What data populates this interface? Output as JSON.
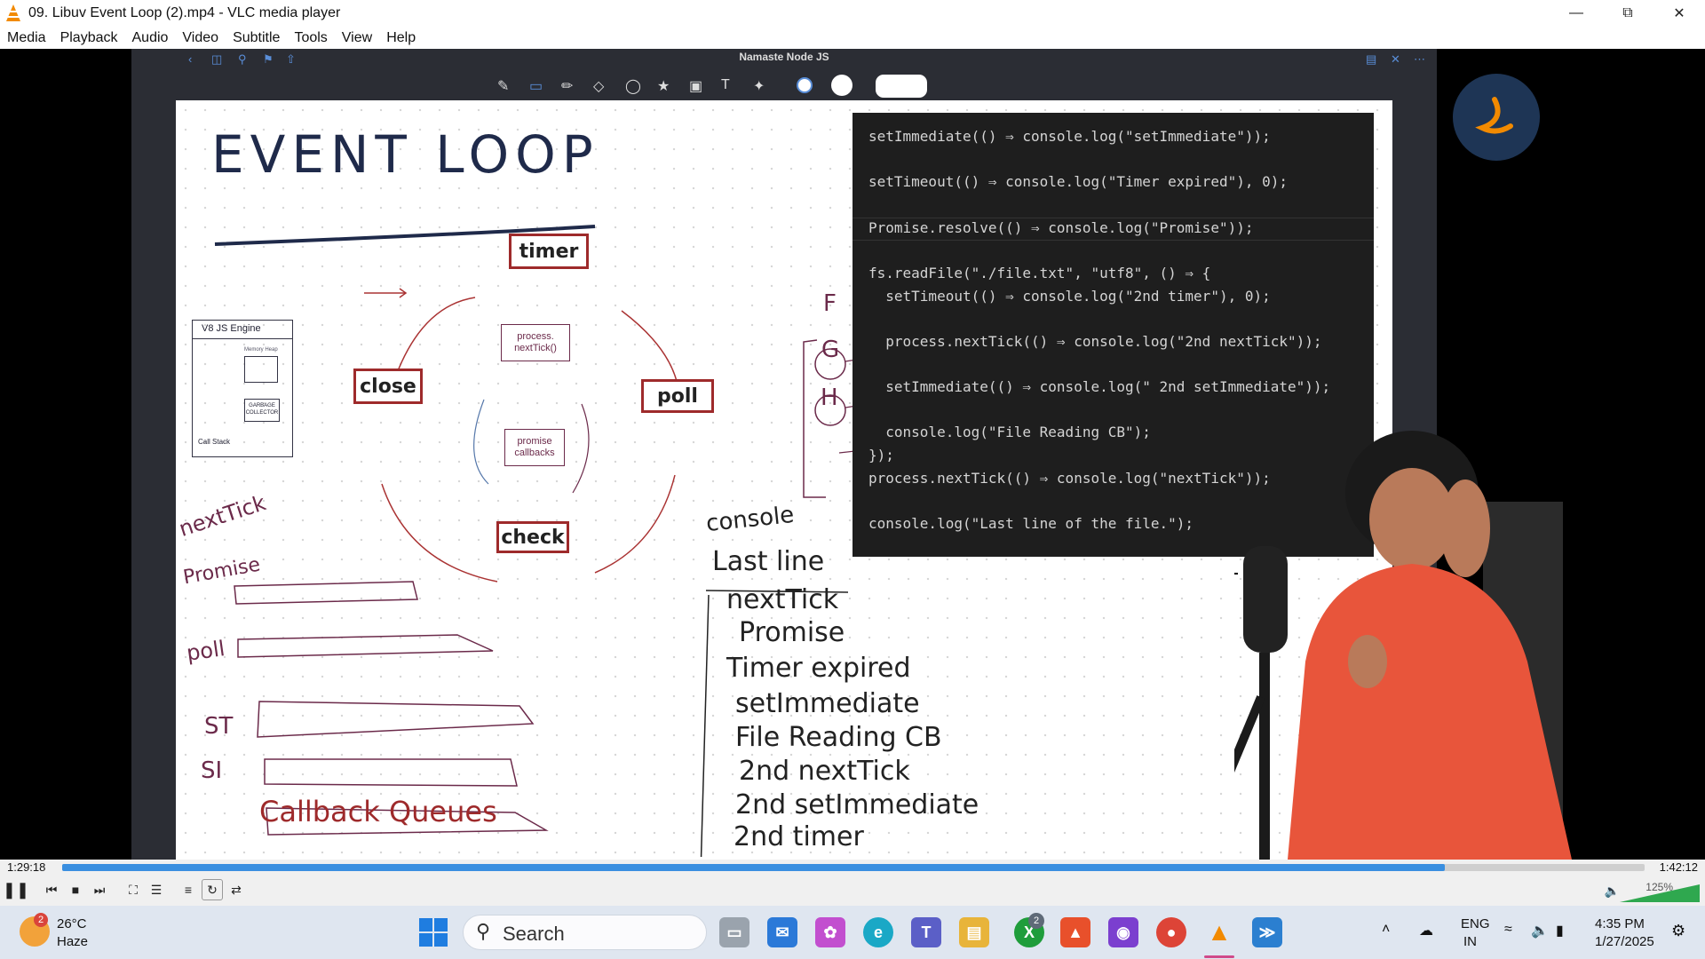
{
  "window": {
    "title": "09. Libuv  Event Loop (2).mp4 - VLC media player",
    "controls": [
      "minimize",
      "maximize",
      "close"
    ]
  },
  "menu": [
    "Media",
    "Playback",
    "Audio",
    "Video",
    "Subtitle",
    "Tools",
    "View",
    "Help"
  ],
  "video": {
    "notebook_title": "Namaste Node JS",
    "whiteboard": {
      "title": "EVENT LOOP",
      "phases": [
        "timer",
        "poll",
        "check",
        "close"
      ],
      "inner_boxes": [
        "process. nextTick()",
        "promise callbacks"
      ],
      "v8_box": {
        "title": "V8 JS Engine",
        "call_stack": "Call Stack",
        "gc": "GARBAGE COLLECTOR",
        "heap": "Memory Heap"
      },
      "queue_labels": [
        "nextTick",
        "Promise",
        "poll",
        "ST",
        "SI"
      ],
      "queues_caption": "Callback Queues",
      "side_marks": [
        "F",
        "G",
        "H"
      ],
      "console_label": "console",
      "console_output": [
        "Last line",
        "nextTick",
        "Promise",
        "Timer expired",
        "setImmediate",
        "File Reading CB",
        "2nd nextTick",
        "2nd setImmediate",
        "2nd timer"
      ]
    },
    "code": [
      "setImmediate(() ⇒ console.log(\"setImmediate\"));",
      "",
      "setTimeout(() ⇒ console.log(\"Timer expired\"), 0);",
      "",
      "Promise.resolve(() ⇒ console.log(\"Promise\"));",
      "",
      "fs.readFile(\"./file.txt\", \"utf8\", () ⇒ {",
      "  setTimeout(() ⇒ console.log(\"2nd timer\"), 0);",
      "",
      "  process.nextTick(() ⇒ console.log(\"2nd nextTick\"));",
      "",
      "  setImmediate(() ⇒ console.log(\" 2nd setImmediate\"));",
      "",
      "  console.log(\"File Reading CB\");",
      "});",
      "process.nextTick(() ⇒ console.log(\"nextTick\"));",
      "",
      "console.log(\"Last line of the file.\");"
    ]
  },
  "player": {
    "time_current": "1:29:18",
    "time_total": "1:42:12",
    "progress": 0.874,
    "volume": "125%"
  },
  "taskbar": {
    "weather_temp": "26°C",
    "weather_desc": "Haze",
    "weather_badge": "2",
    "search_placeholder": "Search",
    "xbox_badge": "2",
    "language": "ENG",
    "region": "IN",
    "clock_time": "4:35 PM",
    "clock_date": "1/27/2025"
  },
  "colors": {
    "accent": "#3a8fe0",
    "phase_border": "#9e2a2b",
    "code_bg": "#1e1e1e",
    "taskbar": "#dfe6f0"
  }
}
